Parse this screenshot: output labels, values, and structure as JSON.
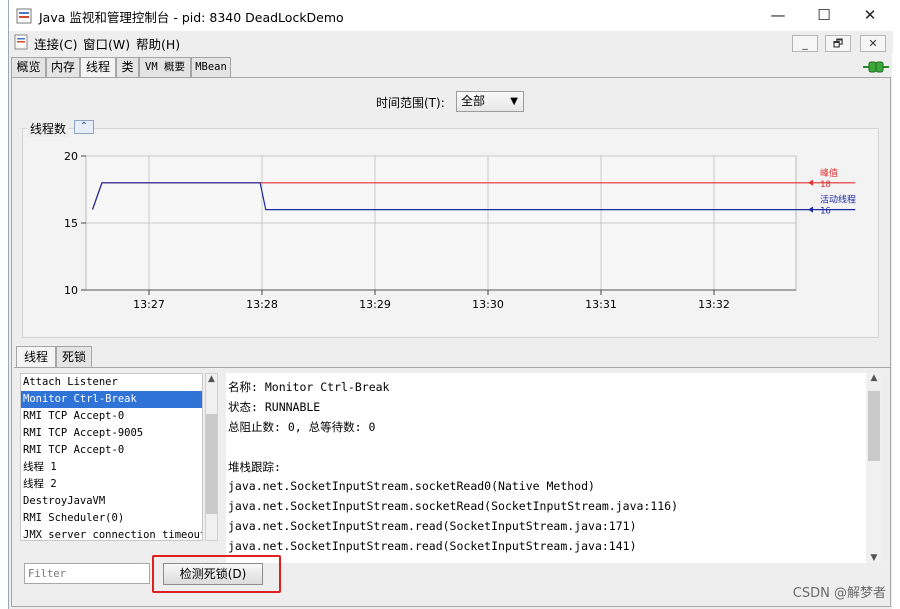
{
  "window": {
    "title": "Java 监视和管理控制台 - pid: 8340 DeadLockDemo",
    "minimize": "—",
    "maximize": "☐",
    "close": "✕"
  },
  "menu": {
    "items": [
      "连接(C)",
      "窗口(W)",
      "帮助(H)"
    ],
    "mdi": [
      "_",
      "🗗",
      "✕"
    ]
  },
  "tabs": [
    "概览",
    "内存",
    "线程",
    "类",
    "VM 概要",
    "MBean"
  ],
  "active_tab": "线程",
  "time_range": {
    "label": "时间范围(T):",
    "value": "全部"
  },
  "chart_panel_title": "线程数",
  "chart_data": {
    "type": "line",
    "title": "线程数",
    "x": [
      "13:27",
      "13:28",
      "13:29",
      "13:30",
      "13:31",
      "13:32"
    ],
    "ylim": [
      10,
      20
    ],
    "yticks": [
      "20",
      "15",
      "10"
    ],
    "series": [
      {
        "name": "峰值",
        "color": "#e03030",
        "value_label": "18",
        "points": [
          [
            "13:26:30",
            16
          ],
          [
            "13:26:35",
            18
          ],
          [
            "13:28:00",
            18
          ],
          [
            "13:33:15",
            18
          ]
        ]
      },
      {
        "name": "活动线程",
        "color": "#1c2aa0",
        "value_label": "16",
        "points": [
          [
            "13:26:30",
            16
          ],
          [
            "13:26:35",
            18
          ],
          [
            "13:27:59",
            18
          ],
          [
            "13:28:02",
            16
          ],
          [
            "13:33:15",
            16
          ]
        ]
      }
    ]
  },
  "bottom_tabs": [
    "线程",
    "死锁"
  ],
  "threads": [
    "Attach Listener",
    "Monitor Ctrl-Break",
    "RMI TCP Accept-0",
    "RMI TCP Accept-9005",
    "RMI TCP Accept-0",
    "线程 1",
    "线程 2",
    "DestroyJavaVM",
    "RMI Scheduler(0)",
    "JMX server connection timeout"
  ],
  "selected_thread": "Monitor Ctrl-Break",
  "detail": [
    "名称: Monitor Ctrl-Break",
    "状态: RUNNABLE",
    "总阻止数: 0, 总等待数: 0",
    "",
    "堆栈跟踪:",
    "java.net.SocketInputStream.socketRead0(Native Method)",
    "java.net.SocketInputStream.socketRead(SocketInputStream.java:116)",
    "java.net.SocketInputStream.read(SocketInputStream.java:171)",
    "java.net.SocketInputStream.read(SocketInputStream.java:141)"
  ],
  "filter_placeholder": "Filter",
  "detect_button": "检测死锁(D)",
  "watermark": "CSDN @解梦者"
}
